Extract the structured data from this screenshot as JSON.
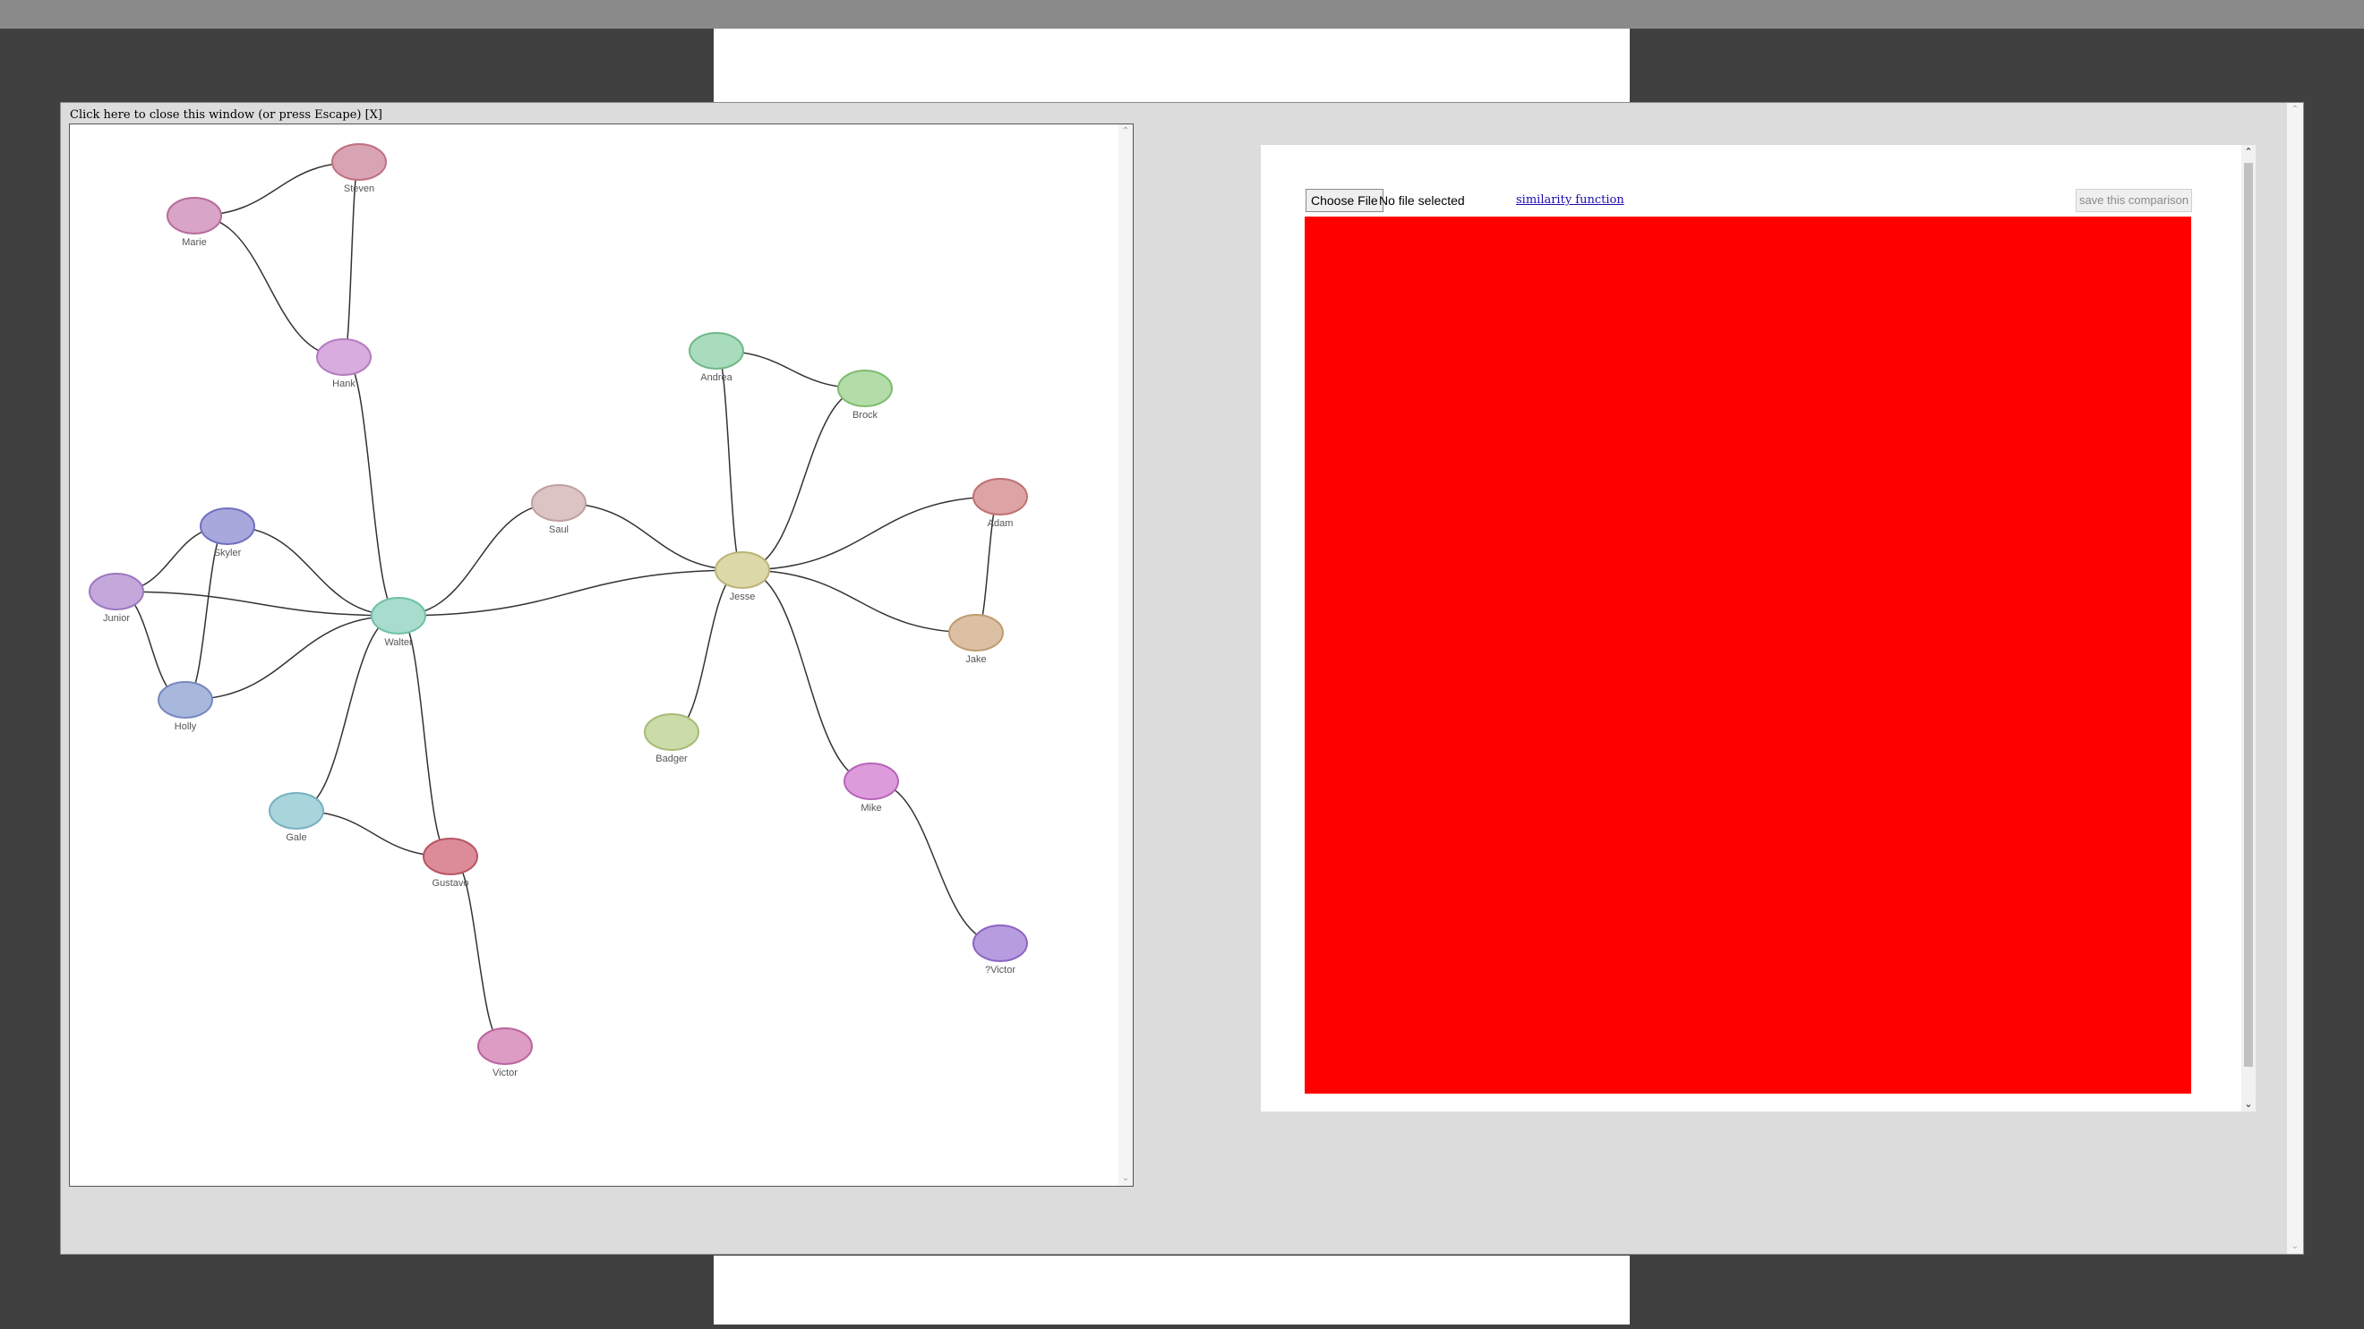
{
  "close_text": "Click here to close this window (or press Escape) [X]",
  "file_input": {
    "button_label": "Choose File",
    "status": "No file selected"
  },
  "similarity_link": "similarity function",
  "save_button": "save this comparison",
  "colors": {
    "canvas": "#ff0000",
    "edge": "#333333"
  },
  "graph": {
    "nodes": [
      {
        "id": "steven",
        "label": "Steven",
        "fill": "#d8a4b4",
        "stroke": "#c07080"
      },
      {
        "id": "marie",
        "label": "Marie",
        "fill": "#d8a4c8",
        "stroke": "#b86c98"
      },
      {
        "id": "hank",
        "label": "Hank",
        "fill": "#d8acdf",
        "stroke": "#b47cc0"
      },
      {
        "id": "andrea",
        "label": "Andrea",
        "fill": "#a8dcbc",
        "stroke": "#70b888"
      },
      {
        "id": "brock",
        "label": "Brock",
        "fill": "#b4dca8",
        "stroke": "#80bc70"
      },
      {
        "id": "saul",
        "label": "Saul",
        "fill": "#dcc4c4",
        "stroke": "#c0a0a0"
      },
      {
        "id": "adam",
        "label": "Adam",
        "fill": "#dca4a4",
        "stroke": "#c07070"
      },
      {
        "id": "skyler",
        "label": "Skyler",
        "fill": "#a8a8dc",
        "stroke": "#7070c0"
      },
      {
        "id": "junior",
        "label": "Junior",
        "fill": "#c4a8dc",
        "stroke": "#9c78c0"
      },
      {
        "id": "jesse",
        "label": "Jesse",
        "fill": "#dcd8a8",
        "stroke": "#bcb478"
      },
      {
        "id": "walter",
        "label": "Walter",
        "fill": "#a8dccc",
        "stroke": "#70c0a8"
      },
      {
        "id": "jake",
        "label": "Jake",
        "fill": "#dcc0a4",
        "stroke": "#c09c70"
      },
      {
        "id": "holly",
        "label": "Holly",
        "fill": "#a8b8dc",
        "stroke": "#7888c0"
      },
      {
        "id": "badger",
        "label": "Badger",
        "fill": "#ccdca8",
        "stroke": "#a4bc78"
      },
      {
        "id": "mike",
        "label": "Mike",
        "fill": "#dc9cdc",
        "stroke": "#b864b8"
      },
      {
        "id": "gale",
        "label": "Gale",
        "fill": "#a8d4dc",
        "stroke": "#78b0c0"
      },
      {
        "id": "gustavo",
        "label": "Gustavo",
        "fill": "#dc8c98",
        "stroke": "#b85464"
      },
      {
        "id": "victor2",
        "label": "?Victor",
        "fill": "#b89ce0",
        "stroke": "#8c64c4"
      },
      {
        "id": "victor",
        "label": "Victor",
        "fill": "#dc9cc4",
        "stroke": "#bc64a0"
      }
    ],
    "edges": [
      [
        "marie",
        "steven"
      ],
      [
        "marie",
        "hank"
      ],
      [
        "steven",
        "hank"
      ],
      [
        "hank",
        "walter"
      ],
      [
        "andrea",
        "brock"
      ],
      [
        "andrea",
        "jesse"
      ],
      [
        "brock",
        "jesse"
      ],
      [
        "saul",
        "walter"
      ],
      [
        "saul",
        "jesse"
      ],
      [
        "walter",
        "jesse"
      ],
      [
        "adam",
        "jesse"
      ],
      [
        "adam",
        "jake"
      ],
      [
        "jake",
        "jesse"
      ],
      [
        "skyler",
        "junior"
      ],
      [
        "skyler",
        "walter"
      ],
      [
        "skyler",
        "holly"
      ],
      [
        "junior",
        "walter"
      ],
      [
        "junior",
        "holly"
      ],
      [
        "holly",
        "walter"
      ],
      [
        "walter",
        "gale"
      ],
      [
        "walter",
        "gustavo"
      ],
      [
        "gale",
        "gustavo"
      ],
      [
        "gustavo",
        "victor"
      ],
      [
        "jesse",
        "badger"
      ],
      [
        "jesse",
        "mike"
      ],
      [
        "mike",
        "victor2"
      ]
    ]
  }
}
